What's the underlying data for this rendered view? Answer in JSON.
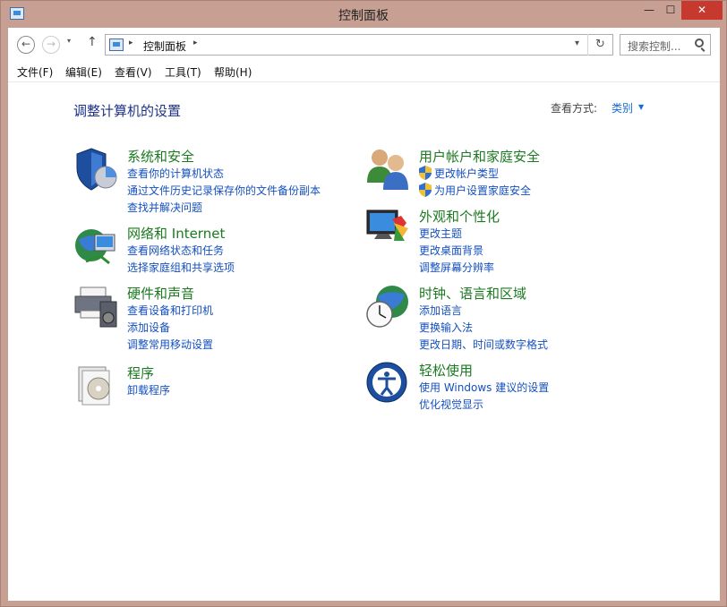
{
  "window": {
    "title": "控制面板"
  },
  "address": {
    "crumb": "控制面板",
    "sep1": "▸",
    "sep2": "▸",
    "dropdown": "▾",
    "refresh": "↻"
  },
  "search": {
    "placeholder": "搜索控制..."
  },
  "nav": {
    "back": "←",
    "forward": "→",
    "recent": "▾",
    "up": "↑"
  },
  "titlebar_buttons": {
    "min": "—",
    "max": "☐",
    "close": "✕"
  },
  "menu": [
    "文件(F)",
    "编辑(E)",
    "查看(V)",
    "工具(T)",
    "帮助(H)"
  ],
  "header": {
    "title": "调整计算机的设置",
    "view_label": "查看方式:",
    "view_value": "类别",
    "view_caret": "▼"
  },
  "categories": {
    "system": {
      "title": "系统和安全",
      "links": [
        "查看你的计算机状态",
        "通过文件历史记录保存你的文件备份副本",
        "查找并解决问题"
      ]
    },
    "network": {
      "title": "网络和 Internet",
      "links": [
        "查看网络状态和任务",
        "选择家庭组和共享选项"
      ]
    },
    "hardware": {
      "title": "硬件和声音",
      "links": [
        "查看设备和打印机",
        "添加设备",
        "调整常用移动设置"
      ]
    },
    "programs": {
      "title": "程序",
      "links": [
        "卸载程序"
      ]
    },
    "users": {
      "title": "用户帐户和家庭安全",
      "links": [
        "更改帐户类型",
        "为用户设置家庭安全"
      ]
    },
    "appearance": {
      "title": "外观和个性化",
      "links": [
        "更改主题",
        "更改桌面背景",
        "调整屏幕分辨率"
      ]
    },
    "clock": {
      "title": "时钟、语言和区域",
      "links": [
        "添加语言",
        "更换输入法",
        "更改日期、时间或数字格式"
      ]
    },
    "ease": {
      "title": "轻松使用",
      "links": [
        "使用 Windows 建议的设置",
        "优化视觉显示"
      ]
    }
  },
  "colors": {
    "title_bar": "#c7a093",
    "link": "#1450c0",
    "category_title": "#1b7a1f",
    "heading": "#1e3287",
    "close": "#c7392f"
  }
}
